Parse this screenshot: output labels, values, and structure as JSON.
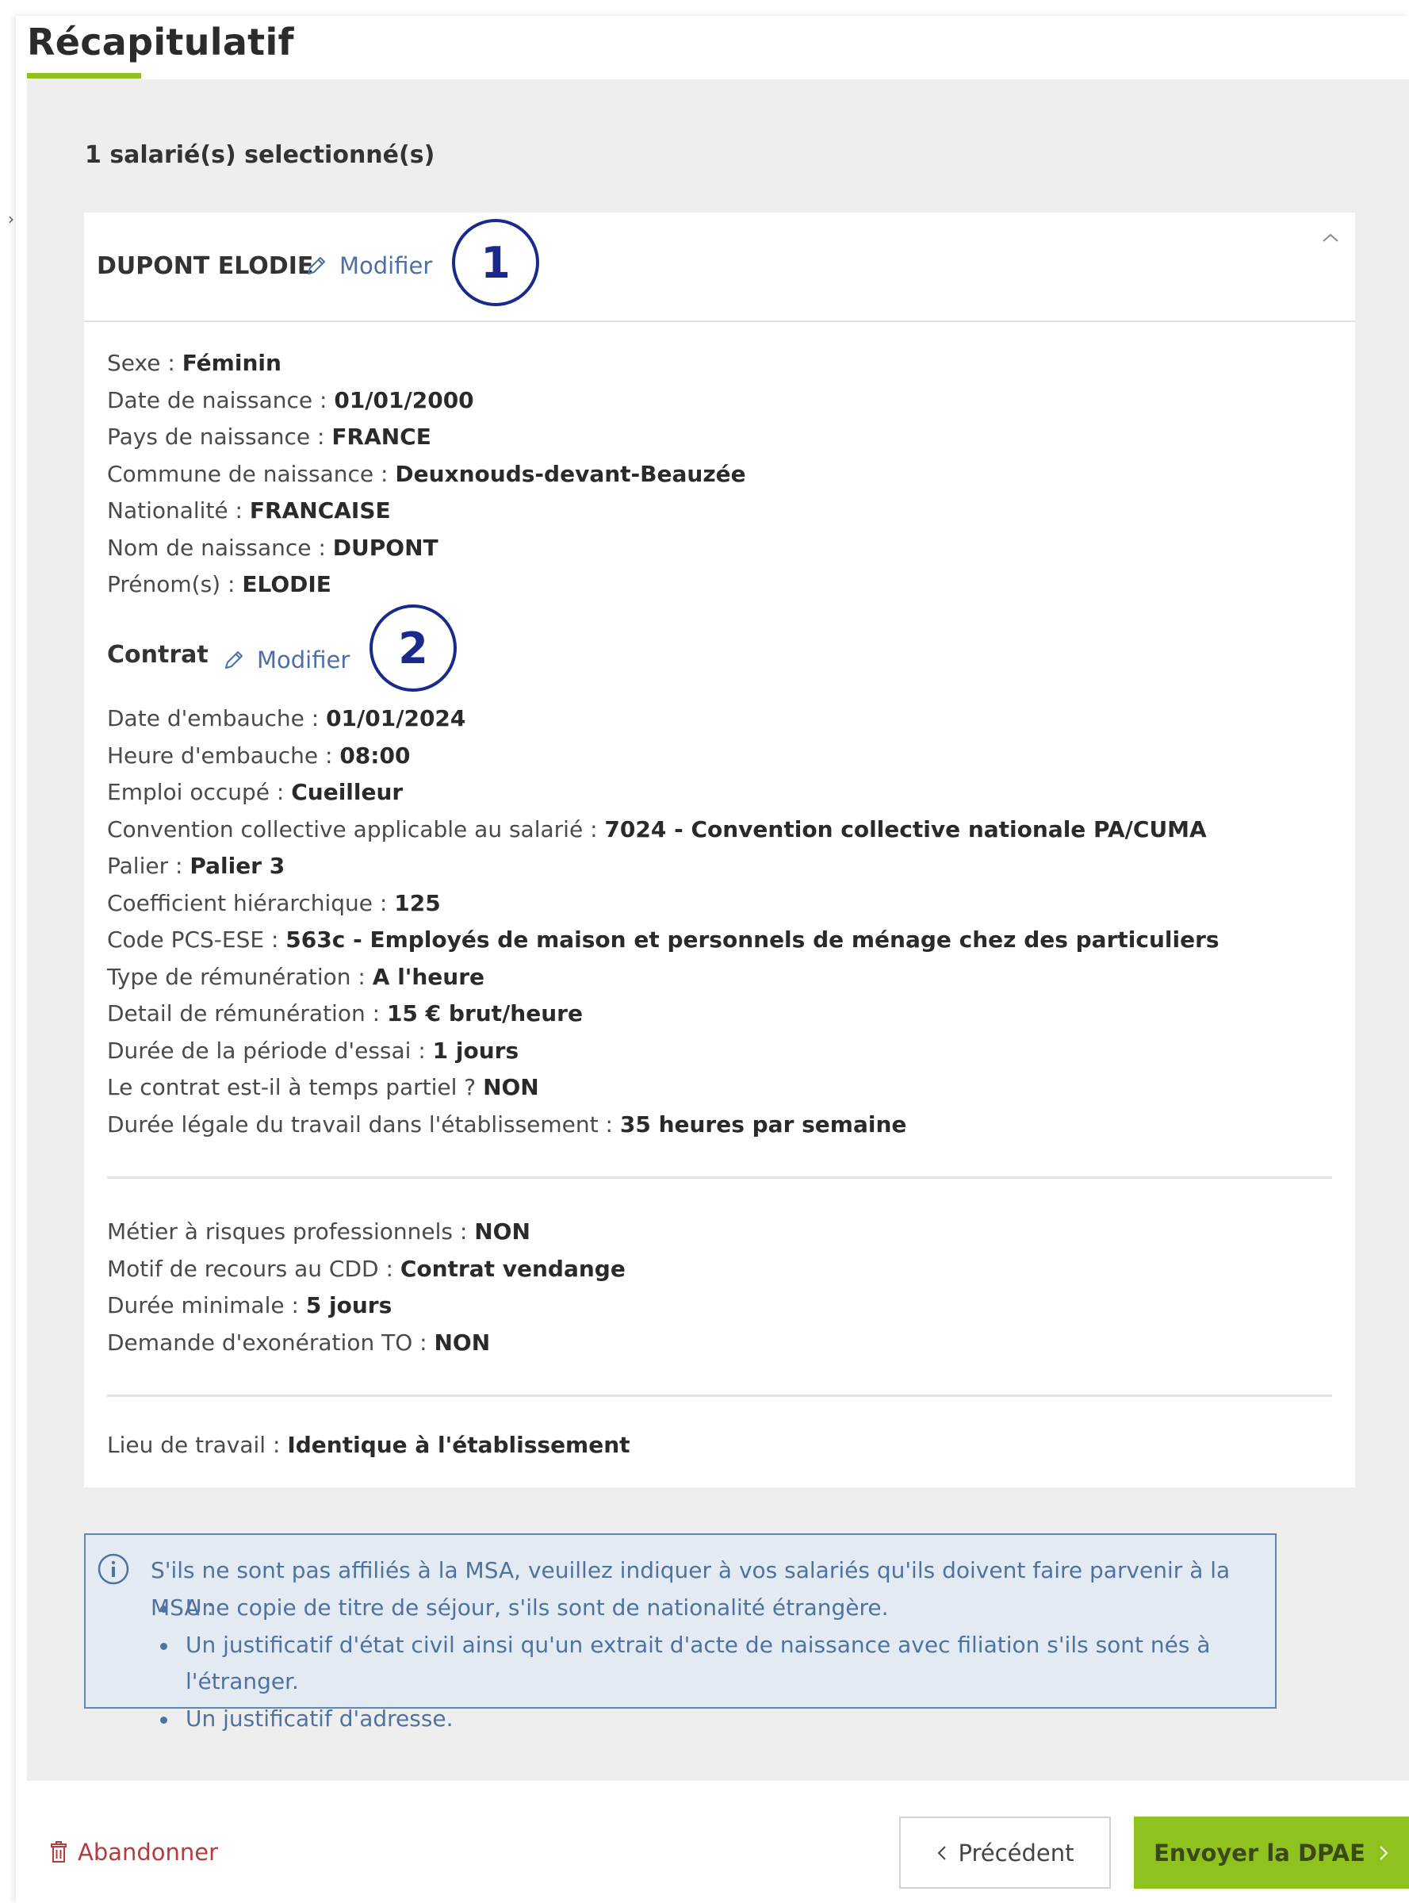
{
  "page": {
    "title": "Récapitulatif"
  },
  "selection": {
    "count_text": "1 salarié(s) selectionné(s)"
  },
  "employee": {
    "name": "DUPONT ELODIE",
    "modify_label": "Modifier",
    "badge_1": "1",
    "identity": [
      {
        "label": "Sexe : ",
        "value": "Féminin"
      },
      {
        "label": "Date de naissance : ",
        "value": "01/01/2000"
      },
      {
        "label": "Pays de naissance : ",
        "value": "FRANCE"
      },
      {
        "label": "Commune de naissance : ",
        "value": "Deuxnouds-devant-Beauzée"
      },
      {
        "label": "Nationalité : ",
        "value": "FRANCAISE"
      },
      {
        "label": "Nom de naissance : ",
        "value": "DUPONT"
      },
      {
        "label": "Prénom(s) : ",
        "value": "ELODIE"
      }
    ],
    "contract": {
      "title": "Contrat",
      "modify_label": "Modifier",
      "badge_2": "2",
      "details": [
        {
          "label": "Date d'embauche : ",
          "value": "01/01/2024"
        },
        {
          "label": "Heure d'embauche : ",
          "value": "08:00"
        },
        {
          "label": "Emploi occupé : ",
          "value": "Cueilleur"
        },
        {
          "label": "Convention collective applicable au salarié : ",
          "value": "7024 - Convention collective nationale PA/CUMA"
        },
        {
          "label": "Palier : ",
          "value": "Palier 3"
        },
        {
          "label": "Coefficient hiérarchique : ",
          "value": "125"
        },
        {
          "label": "Code PCS-ESE : ",
          "value": "563c - Employés de maison et personnels de ménage chez des particuliers"
        },
        {
          "label": "Type de rémunération : ",
          "value": "A l'heure"
        },
        {
          "label": "Detail de rémunération : ",
          "value": "15 € brut/heure"
        },
        {
          "label": "Durée de la période d'essai : ",
          "value": "1 jours"
        },
        {
          "label": "Le contrat est-il à temps partiel ? ",
          "value": "NON"
        },
        {
          "label": "Durée légale du travail dans l'établissement : ",
          "value": "35 heures par semaine"
        }
      ],
      "extra": [
        {
          "label": "Métier à risques professionnels : ",
          "value": "NON"
        },
        {
          "label": "Motif de recours au CDD : ",
          "value": "Contrat vendange"
        },
        {
          "label": "Durée minimale : ",
          "value": "5 jours"
        },
        {
          "label": "Demande d'exonération TO : ",
          "value": "NON"
        }
      ],
      "workplace": {
        "label": "Lieu de travail : ",
        "value": "Identique à l'établissement"
      }
    }
  },
  "info": {
    "intro": "S'ils ne sont pas affiliés à la MSA, veuillez indiquer à vos salariés qu'ils doivent faire parvenir à la MSA :",
    "items": [
      "Une copie de titre de séjour, s'ils sont de nationalité étrangère.",
      "Un justificatif d'état civil ainsi qu'un extrait d'acte de naissance avec filiation s'ils sont nés à l'étranger.",
      "Un justificatif d'adresse."
    ]
  },
  "footer": {
    "abandon_label": "Abandonner",
    "previous_label": "Précédent",
    "submit_label": "Envoyer la DPAE"
  },
  "colors": {
    "accent_green": "#8fc21f",
    "link_blue": "#4d6fa5",
    "badge_navy": "#1a2a8a",
    "info_border": "#5f86b8",
    "info_text": "#4f73a0",
    "danger_red": "#b43c3c"
  },
  "icons": {
    "modify": "pencil-icon",
    "collapse": "chevron-up-icon",
    "info": "info-circle-icon",
    "abandon": "trash-icon",
    "previous": "chevron-left-icon",
    "submit": "chevron-right-icon"
  }
}
